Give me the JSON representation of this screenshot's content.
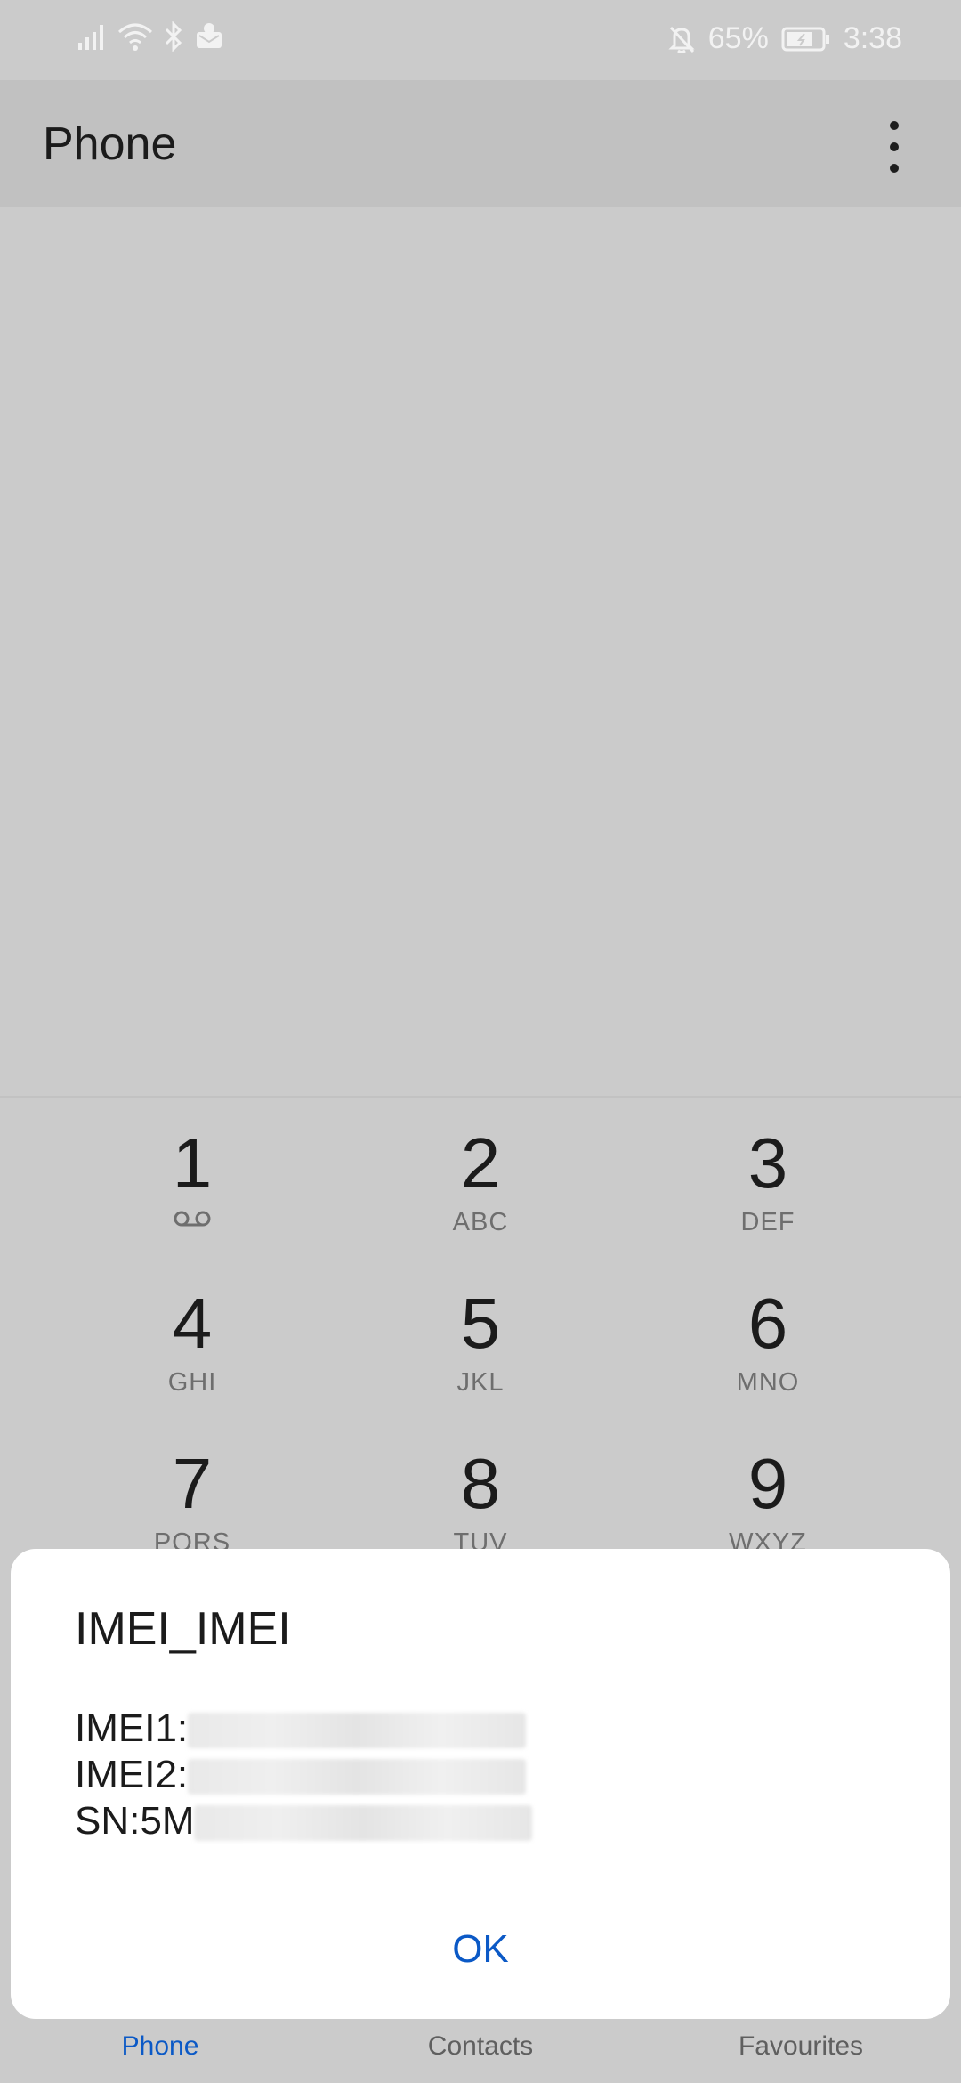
{
  "status_bar": {
    "battery_percent": "65%",
    "time": "3:38",
    "left_icons": [
      "signal-icon",
      "wifi-icon",
      "bluetooth-icon",
      "notification-app-icon"
    ],
    "right_icons": [
      "bell-off-icon",
      "battery-icon"
    ]
  },
  "app_bar": {
    "title": "Phone"
  },
  "keypad": {
    "keys": [
      {
        "digit": "1",
        "letters": ""
      },
      {
        "digit": "2",
        "letters": "ABC"
      },
      {
        "digit": "3",
        "letters": "DEF"
      },
      {
        "digit": "4",
        "letters": "GHI"
      },
      {
        "digit": "5",
        "letters": "JKL"
      },
      {
        "digit": "6",
        "letters": "MNO"
      },
      {
        "digit": "7",
        "letters": "PQRS"
      },
      {
        "digit": "8",
        "letters": "TUV"
      },
      {
        "digit": "9",
        "letters": "WXYZ"
      }
    ]
  },
  "bottom_nav": {
    "items": [
      {
        "label": "Phone",
        "active": true
      },
      {
        "label": "Contacts",
        "active": false
      },
      {
        "label": "Favourites",
        "active": false
      }
    ]
  },
  "dialog": {
    "title": "IMEI_IMEI",
    "lines": [
      {
        "label": "IMEI1:",
        "value_redacted": true
      },
      {
        "label": "IMEI2:",
        "value_redacted": true
      },
      {
        "label": "SN:5M",
        "value_redacted": true
      }
    ],
    "ok_label": "OK"
  },
  "colors": {
    "accent": "#0b59c6",
    "scrim": "#cbcbcb",
    "dialog_bg": "#ffffff"
  }
}
